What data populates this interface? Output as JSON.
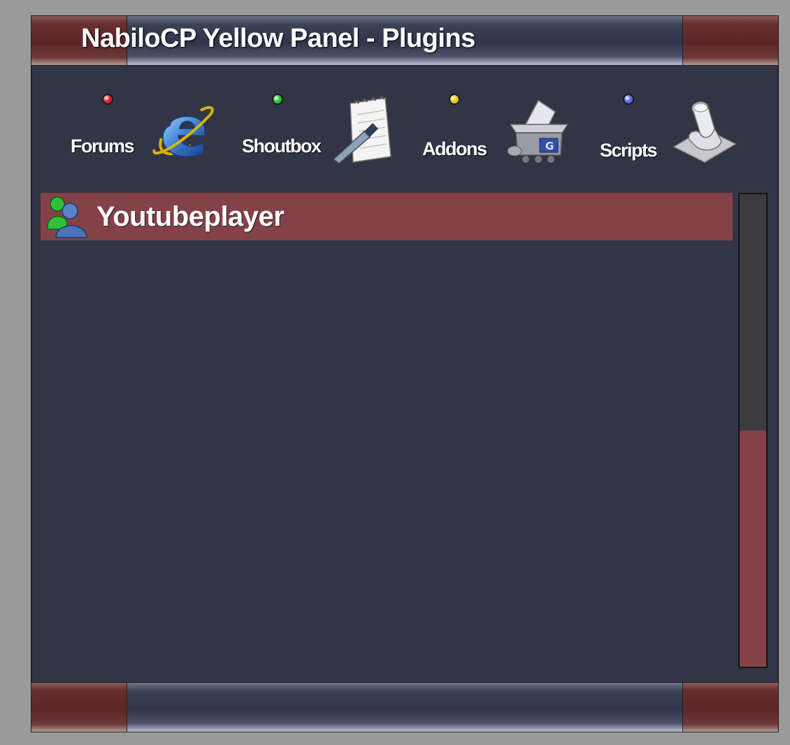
{
  "window": {
    "title": "NabiloCP Yellow Panel - Plugins"
  },
  "nav": {
    "items": [
      {
        "label": "Forums",
        "dot_color": "#e02020",
        "icon": "internet-explorer-icon"
      },
      {
        "label": "Shoutbox",
        "dot_color": "#22cc22",
        "icon": "notepad-pen-icon"
      },
      {
        "label": "Addons",
        "dot_color": "#e8c800",
        "icon": "package-box-icon"
      },
      {
        "label": "Scripts",
        "dot_color": "#5566ee",
        "icon": "scroll-paper-icon"
      }
    ]
  },
  "plugins": {
    "items": [
      {
        "label": "Youtubeplayer",
        "icon": "user-plugin-icon"
      }
    ]
  },
  "scrollbar": {
    "thumb_start_fraction": 0.5,
    "thumb_end_fraction": 1.0
  },
  "colors": {
    "panel_bg": "#323546",
    "accent": "#854148",
    "titlebar_cap": "#5a2626"
  }
}
